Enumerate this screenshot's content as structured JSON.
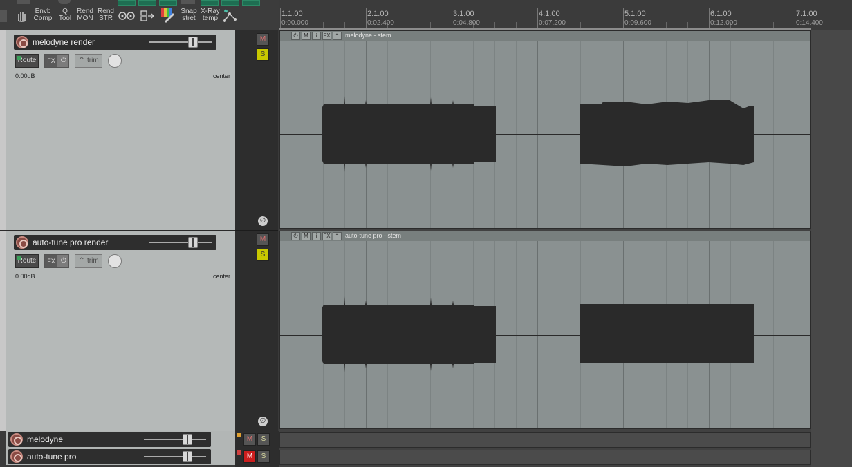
{
  "toolbar": {
    "envb_comp": [
      "Envb",
      "Comp"
    ],
    "q_tool": [
      "Q",
      "Tool"
    ],
    "rend_mon": [
      "Rend",
      "MON"
    ],
    "rend_str": [
      "Rend",
      "STR"
    ],
    "snap_stret": [
      "Snap",
      "stret"
    ],
    "xray_temp": [
      "X-Ray",
      "temp"
    ]
  },
  "ruler": {
    "markers": [
      {
        "bar": "1.1.00",
        "time": "0:00.000"
      },
      {
        "bar": "2.1.00",
        "time": "0:02.400"
      },
      {
        "bar": "3.1.00",
        "time": "0:04.800"
      },
      {
        "bar": "4.1.00",
        "time": "0:07.200"
      },
      {
        "bar": "5.1.00",
        "time": "0:09.600"
      },
      {
        "bar": "6.1.00",
        "time": "0:12.000"
      },
      {
        "bar": "7.1.00",
        "time": "0:14.400"
      }
    ]
  },
  "tracks": [
    {
      "name": "melodyne render",
      "route_label": "Route",
      "fx_label": "FX",
      "trim_label": "trim",
      "volume": "0.00dB",
      "pan": "center",
      "mute_label": "M",
      "solo_label": "S",
      "phase_label": "∅",
      "item_name": "melodyne - stem"
    },
    {
      "name": "auto-tune pro render",
      "route_label": "Route",
      "fx_label": "FX",
      "trim_label": "trim",
      "volume": "0.00dB",
      "pan": "center",
      "mute_label": "M",
      "solo_label": "S",
      "phase_label": "∅",
      "item_name": "auto-tune pro - stem"
    },
    {
      "name": "melodyne",
      "mute_label": "M",
      "solo_label": "S"
    },
    {
      "name": "auto-tune pro",
      "mute_label": "M",
      "solo_label": "S"
    }
  ],
  "colors": {
    "solo_active": "#c8c800",
    "mute_active": "#cc1e1e",
    "route_green": "#3aa05a"
  }
}
